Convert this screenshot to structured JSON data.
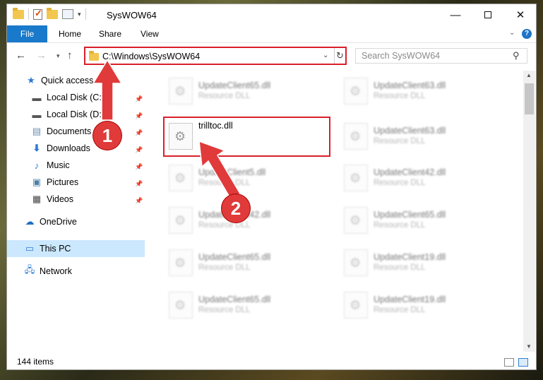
{
  "window": {
    "title": "SysWOW64"
  },
  "ribbon": {
    "tabs": [
      "File",
      "Home",
      "Share",
      "View"
    ],
    "help": "?"
  },
  "navbar": {
    "address": "C:\\Windows\\SysWOW64",
    "search_placeholder": "Search SysWOW64"
  },
  "navpane": {
    "items": [
      {
        "label": "Quick access",
        "icon": "star-icon"
      },
      {
        "label": "Local Disk (C:)",
        "icon": "drive-icon",
        "pinned": true
      },
      {
        "label": "Local Disk (D:)",
        "icon": "drive-icon",
        "pinned": true
      },
      {
        "label": "Documents",
        "icon": "documents-icon",
        "pinned": true
      },
      {
        "label": "Downloads",
        "icon": "download-icon",
        "pinned": true
      },
      {
        "label": "Music",
        "icon": "music-icon",
        "pinned": true
      },
      {
        "label": "Pictures",
        "icon": "pictures-icon",
        "pinned": true
      },
      {
        "label": "Videos",
        "icon": "videos-icon",
        "pinned": true
      },
      {
        "label": "OneDrive",
        "icon": "cloud-icon"
      },
      {
        "label": "This PC",
        "icon": "computer-icon",
        "selected": true
      },
      {
        "label": "Network",
        "icon": "network-icon"
      }
    ]
  },
  "files": {
    "left": [
      {
        "name": "UpdateClient65.dll",
        "type": "Resource DLL"
      },
      {
        "name": "trilltoc.dll",
        "type": ""
      },
      {
        "name": "UpdateClient5.dll",
        "type": "Resource DLL"
      },
      {
        "name": "UpdateClient42.dll",
        "type": "Resource DLL"
      },
      {
        "name": "UpdateClient65.dll",
        "type": "Resource DLL"
      },
      {
        "name": "UpdateClient65.dll",
        "type": "Resource DLL"
      }
    ],
    "right": [
      {
        "name": "UpdateClient63.dll",
        "type": "Resource DLL"
      },
      {
        "name": "UpdateClient63.dll",
        "type": "Resource DLL"
      },
      {
        "name": "UpdateClient42.dll",
        "type": "Resource DLL"
      },
      {
        "name": "UpdateClient65.dll",
        "type": "Resource DLL"
      },
      {
        "name": "UpdateClient19.dll",
        "type": "Resource DLL"
      },
      {
        "name": "UpdateClient19.dll",
        "type": "Resource DLL"
      }
    ]
  },
  "status": {
    "items_count": "144 items"
  },
  "annotations": {
    "step1": "1",
    "step2": "2",
    "color": "#e03a3a"
  }
}
